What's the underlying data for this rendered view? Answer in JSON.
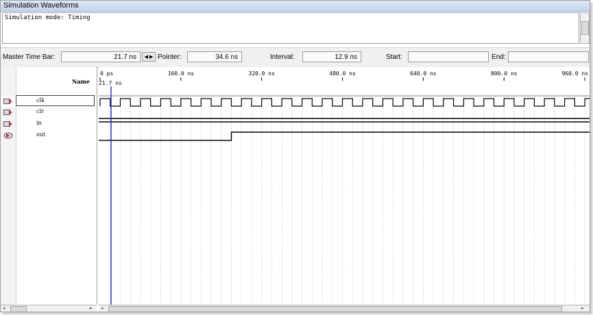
{
  "window": {
    "title": "Simulation Waveforms"
  },
  "description": {
    "text": "Simulation mode: Timing"
  },
  "timebar": {
    "master_label": "Master Time Bar:",
    "master_value": "21.7 ns",
    "pointer_label": "Pointer:",
    "pointer_value": "34.6 ns",
    "interval_label": "Interval:",
    "interval_value": "12.9 ns",
    "start_label": "Start:",
    "start_value": "",
    "end_label": "End:",
    "end_value": ""
  },
  "name_column": {
    "header": "Name"
  },
  "signals": [
    {
      "name": "clk",
      "type": "input",
      "icon": "input-pin-icon"
    },
    {
      "name": "clr",
      "type": "input",
      "icon": "input-pin-icon"
    },
    {
      "name": "in",
      "type": "input",
      "icon": "input-pin-icon"
    },
    {
      "name": "out",
      "type": "output",
      "icon": "output-pin-icon"
    }
  ],
  "timeline": {
    "ticks": [
      "0 ps",
      "160.0 ns",
      "320.0 ns",
      "480.0 ns",
      "640.0 ns",
      "800.0 ns",
      "960.0 ns"
    ],
    "tick_values_ns": [
      0,
      160,
      320,
      480,
      640,
      800,
      960
    ],
    "master_marker_label": "21.7 ns",
    "master_marker_ns": 21.7,
    "clock_period_ns": 40,
    "out_rise_ns": 260
  },
  "colors": {
    "marker": "#3333cc",
    "grid": "#c8c8c8",
    "signal": "#000000"
  }
}
